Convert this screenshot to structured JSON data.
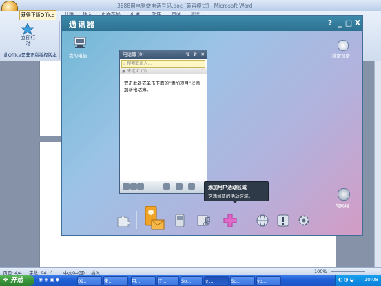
{
  "word": {
    "title": "3688用电脑做电话号码.doc [兼容模式] - Microsoft Word",
    "ribbon_tabs": [
      "开始",
      "插入",
      "页面布局",
      "引用",
      "邮件",
      "审阅",
      "视图"
    ],
    "active_tab": "获得正版Office",
    "ribbon_button": "立即行动",
    "ribbon_group_label": "此Office是非正版授权版本",
    "status": {
      "page": "页面: 4/4",
      "words": "字数: 94",
      "language": "中文(中国)",
      "mode": "插入",
      "zoom": "100%"
    }
  },
  "communicator": {
    "title": "通讯器",
    "controls": {
      "help": "?",
      "minimize": "_",
      "restore": "□",
      "close": "X"
    },
    "my_computer": "我的电脑",
    "search_device": "搜索设备",
    "network": "的网络",
    "contacts": {
      "title": "电话簿 (0)",
      "search_placeholder": "搜索联系人...",
      "group": "未定义 (0)",
      "hint": "双击此处或单击下面的\"添加项目\"以添加新电话簿。"
    },
    "tooltip": {
      "title": "添加用户活动区域",
      "body": "这添加新的活动区域。"
    },
    "dock_icons": [
      "puzzle-icon",
      "contacts-mail-icon",
      "phone-icon",
      "media-icon",
      "add-icon",
      "globe-icon",
      "alert-icon",
      "settings-icon"
    ]
  },
  "taskbar": {
    "start": "开始",
    "tasks": [
      "09...",
      "未...",
      "用...",
      "江...",
      "So...",
      "文...",
      "So...",
      "vo..."
    ],
    "clock": "10:08"
  },
  "colors": {
    "accent": "#2e7191",
    "tooltip_bg": "#2f3a48",
    "taskbar": "#1f5fd6"
  }
}
